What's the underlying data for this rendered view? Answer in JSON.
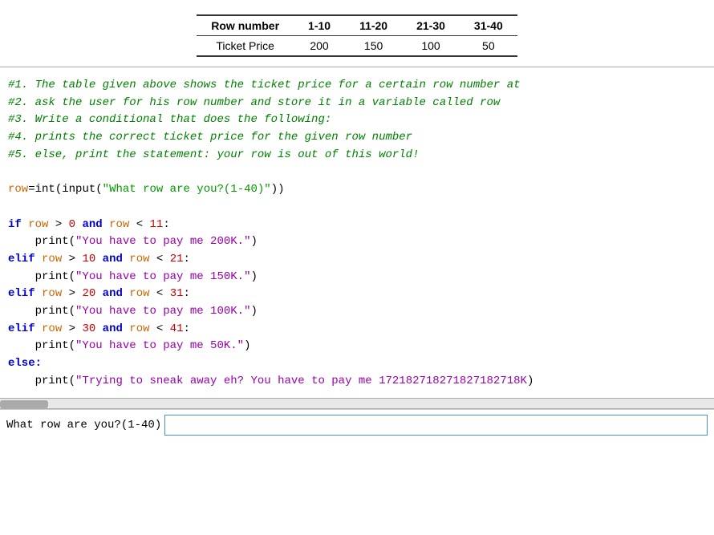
{
  "table": {
    "headers": [
      "Row number",
      "1-10",
      "11-20",
      "21-30",
      "31-40"
    ],
    "rows": [
      [
        "Ticket Price",
        "200",
        "150",
        "100",
        "50"
      ]
    ]
  },
  "comments": [
    "#1. The table given above shows the ticket price for a certain row number at",
    "#2. ask the user for his row number and store it in a variable called row",
    "#3. Write a conditional that does the following:",
    "#4. prints the correct ticket price for the given row number",
    "#5. else, print the statement: your row is out of this world!"
  ],
  "input_prompt": "What row are you?(1-40) ",
  "input_value": ""
}
